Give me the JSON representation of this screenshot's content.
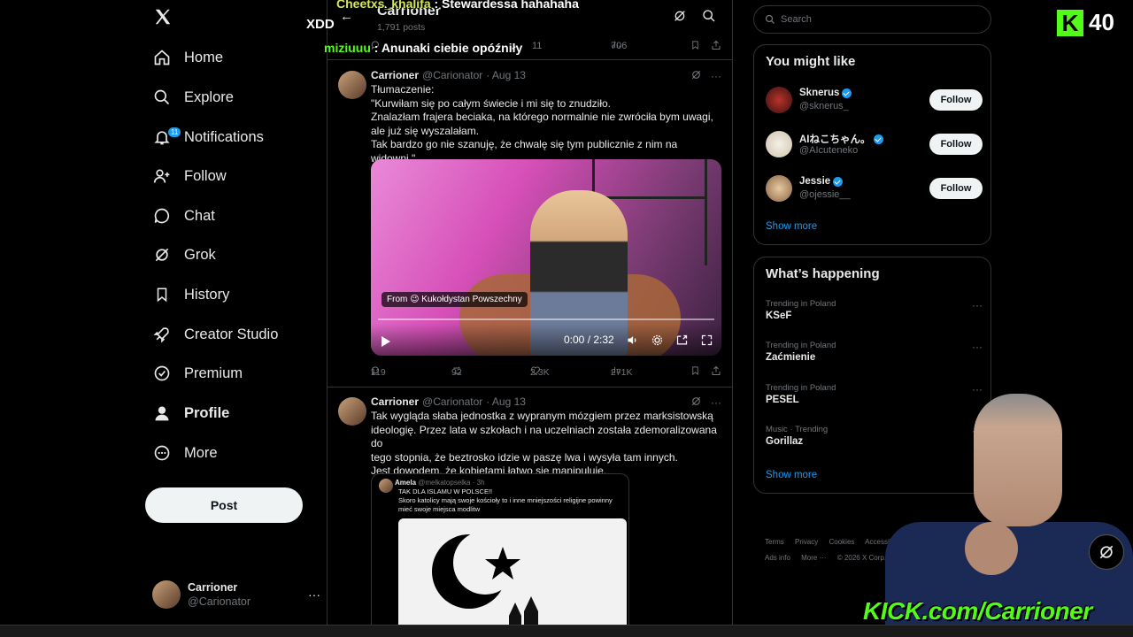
{
  "nav": {
    "items": [
      {
        "label": "Home",
        "icon": "home-icon"
      },
      {
        "label": "Explore",
        "icon": "search-icon"
      },
      {
        "label": "Notifications",
        "icon": "bell-icon",
        "badge": "11"
      },
      {
        "label": "Follow",
        "icon": "person-add-icon"
      },
      {
        "label": "Chat",
        "icon": "chat-icon"
      },
      {
        "label": "Grok",
        "icon": "grok-icon"
      },
      {
        "label": "History",
        "icon": "bookmark-icon"
      },
      {
        "label": "Creator Studio",
        "icon": "rocket-icon"
      },
      {
        "label": "Premium",
        "icon": "verified-icon"
      },
      {
        "label": "Profile",
        "icon": "person-icon"
      },
      {
        "label": "More",
        "icon": "more-icon"
      }
    ],
    "post_label": "Post",
    "account": {
      "name": "Carrioner",
      "handle": "@Carionator",
      "more": "···"
    }
  },
  "timeline": {
    "header": {
      "title": "Carrioner",
      "subtitle": "1,791 posts"
    },
    "top_actions": {
      "replies": "",
      "reposts": "11",
      "views": "706"
    },
    "tweets": [
      {
        "name": "Carrioner",
        "handle": "@Carionator",
        "date": "· Aug 13",
        "text": "Tłumaczenie:\n\"Kurwiłam się po całym świecie i mi się to znudziło.\nZnalazłam frajera beciaka, na którego normalnie nie zwróciła bym uwagi,\nale już się wyszalałam.\nTak bardzo go nie szanuję, że chwalę się tym publicznie z nim na widowni.\"",
        "video": {
          "from": "From 😉 Kukołdystan Powszechny",
          "time": "0:00 / 2:32"
        },
        "metrics": {
          "replies": "119",
          "reposts": "92",
          "likes": "2.3K",
          "views": "271K"
        }
      },
      {
        "name": "Carrioner",
        "handle": "@Carionator",
        "date": "· Aug 13",
        "text": "Tak wygląda słaba jednostka z wypranym mózgiem przez marksistowską\nideologię. Przez lata w szkołach i na uczelniach została zdemoralizowana do\ntego stopnia, że beztrosko idzie w paszę lwa i wysyła tam innych.\nJest dowodem, że kobietami łatwo się manipuluje.",
        "quote": {
          "author": "Amela",
          "handle": "@melkatopselka · 3h",
          "text": "TAK DLA ISLAMU W POLSCE!!\nSkoro katolicy mają swoje kościoły to i inne mniejszości religijne powinny\nmieć swoje miejsca modlitw"
        }
      }
    ]
  },
  "right": {
    "search_placeholder": "Search",
    "you_might_like": {
      "title": "You might like",
      "users": [
        {
          "name": "Sknerus",
          "handle": "@sknerus_",
          "verified": true
        },
        {
          "name": "AIねこちゃん。",
          "handle": "@AIcuteneko",
          "verified": true
        },
        {
          "name": "Jessie",
          "handle": "@ojessie__",
          "verified": true
        }
      ],
      "follow_label": "Follow",
      "show_more": "Show more"
    },
    "whats_happening": {
      "title": "What’s happening",
      "trends": [
        {
          "context": "Trending in Poland",
          "topic": "KSeF"
        },
        {
          "context": "Trending in Poland",
          "topic": "Zaćmienie"
        },
        {
          "context": "Trending in Poland",
          "topic": "PESEL"
        },
        {
          "context": "Music · Trending",
          "topic": "Gorillaz"
        }
      ],
      "show_more": "Show more"
    },
    "footer": [
      "Terms",
      "Privacy",
      "Cookies",
      "Accessibility",
      "Ads info",
      "More ···",
      "© 2026 X Corp."
    ]
  },
  "overlay": {
    "chat": [
      {
        "user": "Cheetxs_khalifa",
        "message": ": Stewardessa hahahaha"
      },
      {
        "user": "miziuuu",
        "message": ": Anunaki ciebie opóźniły"
      }
    ],
    "xdd": "XDD",
    "viewer_count": "40",
    "kick_letter": "K",
    "kick_url": "KICK.com/Carrioner"
  },
  "colors": {
    "accent": "#1d9bf0",
    "kick_green": "#53fc18",
    "border": "#2f3336",
    "muted": "#71767b"
  }
}
